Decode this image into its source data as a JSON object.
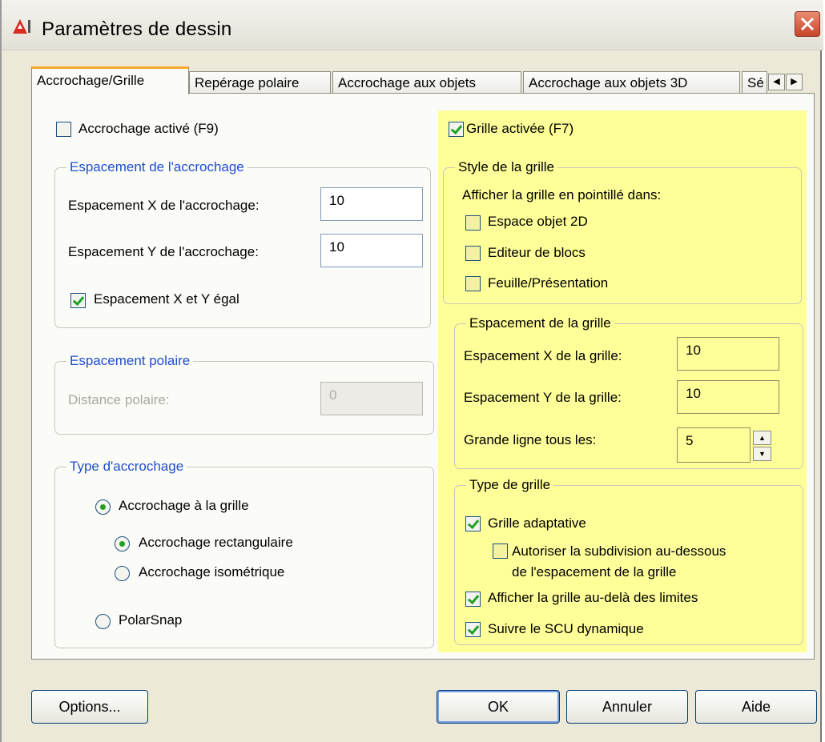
{
  "window": {
    "title": "Paramètres de dessin"
  },
  "tabs": [
    "Accrochage/Grille",
    "Repérage polaire",
    "Accrochage aux objets",
    "Accrochage aux objets 3D",
    "Sé"
  ],
  "snap": {
    "enabled_label": "Accrochage activé (F9)",
    "enabled": false,
    "spacing_group": "Espacement de l'accrochage",
    "x_label": "Espacement X de l'accrochage:",
    "x_value": "10",
    "y_label": "Espacement Y de l'accrochage:",
    "y_value": "10",
    "equal_label": "Espacement X et Y égal",
    "equal_checked": true
  },
  "polar": {
    "group": "Espacement polaire",
    "distance_label": "Distance polaire:",
    "distance_value": "0"
  },
  "snap_type": {
    "group": "Type d'accrochage",
    "grid_snap": "Accrochage à la grille",
    "rectangular": "Accrochage rectangulaire",
    "isometric": "Accrochage isométrique",
    "polarsnap": "PolarSnap",
    "selected": "grid_snap",
    "grid_sub_selected": "rectangular"
  },
  "grid": {
    "enabled_label": "Grille activée (F7)",
    "enabled": true,
    "style_group": "Style de la grille",
    "style_caption": "Afficher la grille en pointillé dans:",
    "style_items": [
      "Espace objet 2D",
      "Editeur de blocs",
      "Feuille/Présentation"
    ],
    "spacing_group": "Espacement de la grille",
    "x_label": "Espacement X de la grille:",
    "x_value": "10",
    "y_label": "Espacement Y de la grille:",
    "y_value": "10",
    "major_label": "Grande ligne tous les:",
    "major_value": "5",
    "type_group": "Type de grille",
    "adaptive": "Grille adaptative",
    "subdivision_line1": "Autoriser la subdivision au-dessous",
    "subdivision_line2": "de l'espacement de la grille",
    "beyond_limits": "Afficher la grille au-delà des limites",
    "follow_ucs": "Suivre le SCU dynamique"
  },
  "buttons": {
    "options": "Options...",
    "ok": "OK",
    "cancel": "Annuler",
    "help": "Aide"
  },
  "colors": {
    "highlight": "#ffff99",
    "group_title": "#1f4fcf",
    "check": "#21a121",
    "tab_active_accent": "#f6a82b"
  }
}
